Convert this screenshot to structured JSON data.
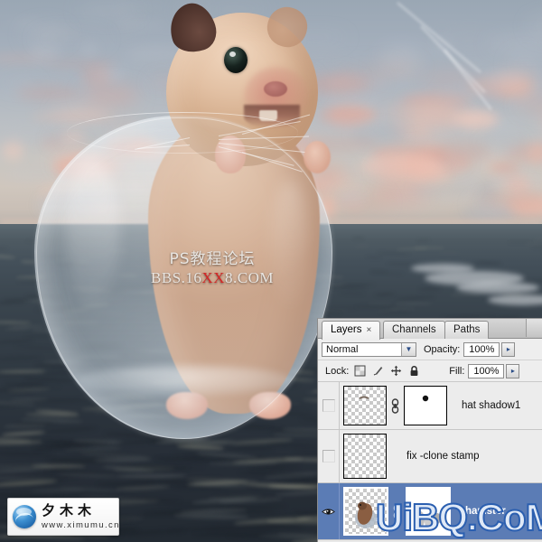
{
  "photo": {
    "description": "hamster inside a glass fishbowl over ocean sunset",
    "watermark_center": {
      "line1": "PS教程论坛",
      "line2_pre": "BBS.16",
      "line2_red": "XX",
      "line2_post": "8.COM",
      "red_color": "#d42525",
      "text_color": "#e9e6e2"
    },
    "logo": {
      "name": "夕木木",
      "url": "www.ximumu.cn",
      "orb_color": "#0d4f96"
    },
    "overlay_watermark": "UiBQ.CoM",
    "overlay_watermark_fill": "#dfe9f7",
    "overlay_watermark_stroke": "#2b5fb0"
  },
  "panel": {
    "tabs": [
      {
        "label": "Layers",
        "close": "×",
        "active": true
      },
      {
        "label": "Channels",
        "active": false
      },
      {
        "label": "Paths",
        "active": false
      }
    ],
    "blend_mode": {
      "value": "Normal",
      "arrow": "▼"
    },
    "opacity": {
      "label": "Opacity:",
      "value": "100%",
      "arrow": "▸"
    },
    "lock": {
      "label": "Lock:",
      "icons": [
        "lock-transparency-icon",
        "lock-image-icon",
        "lock-position-icon",
        "lock-all-icon"
      ]
    },
    "fill": {
      "label": "Fill:",
      "value": "100%",
      "arrow": "▸"
    },
    "layers": [
      {
        "name": "hat shadow1",
        "visible": false,
        "has_mask": true,
        "linked": true,
        "selected": false
      },
      {
        "name": "fix -clone stamp",
        "visible": false,
        "has_mask": false,
        "linked": false,
        "selected": false
      },
      {
        "name": "hamster",
        "visible": true,
        "has_mask": true,
        "linked": true,
        "selected": true
      }
    ],
    "selection_color": "#5b7cb5"
  }
}
